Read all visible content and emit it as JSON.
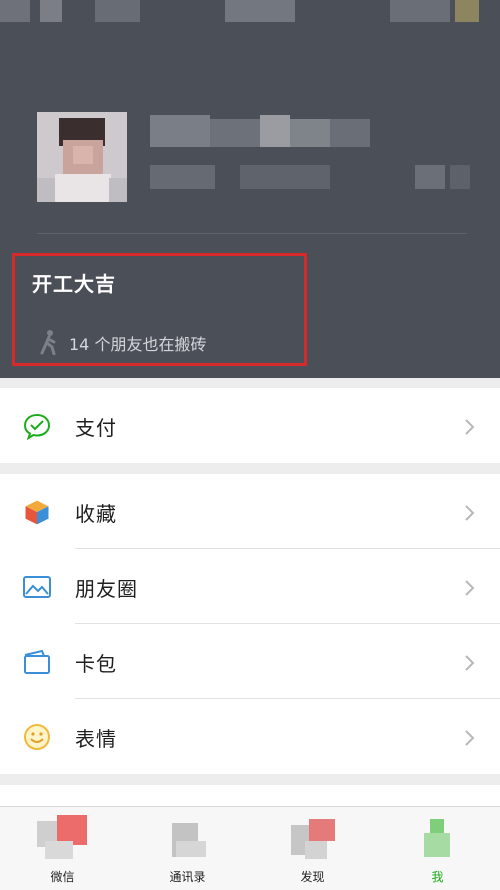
{
  "status": {
    "title": "开工大吉",
    "friends_text": "14 个朋友也在搬砖"
  },
  "menu": {
    "pay": {
      "label": "支付",
      "icon": "pay-icon"
    },
    "favorites": {
      "label": "收藏",
      "icon": "favorites-cube-icon"
    },
    "moments": {
      "label": "朋友圈",
      "icon": "moments-picture-icon"
    },
    "cards": {
      "label": "卡包",
      "icon": "card-wallet-icon"
    },
    "stickers": {
      "label": "表情",
      "icon": "smiley-icon"
    }
  },
  "tabs": [
    {
      "label": "微信"
    },
    {
      "label": "通讯录"
    },
    {
      "label": "发现"
    },
    {
      "label": "我"
    }
  ],
  "colors": {
    "header_bg": "#4b4f58",
    "highlight_border": "#d6292a",
    "wechat_green": "#1aad19"
  }
}
